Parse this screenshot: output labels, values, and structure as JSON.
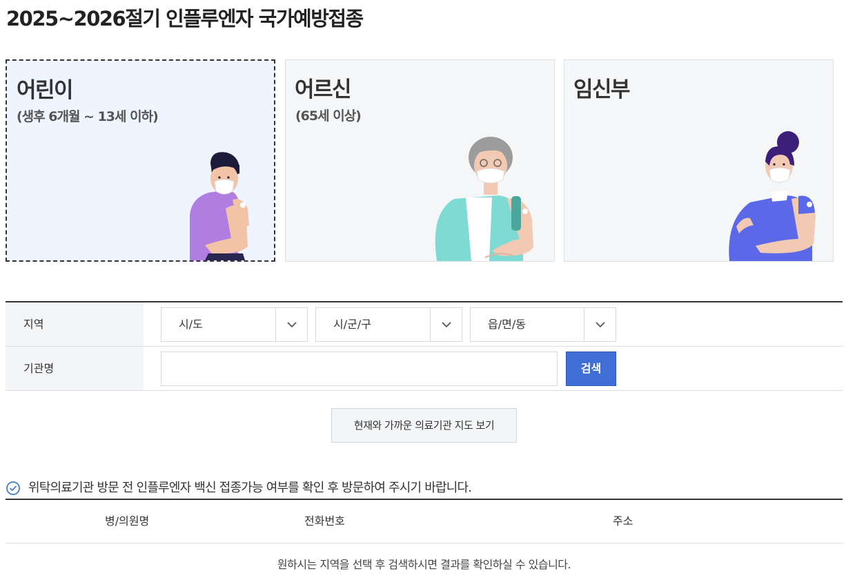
{
  "page": {
    "title": "2025~2026절기 인플루엔자 국가예방접종"
  },
  "cards": [
    {
      "title": "어린이",
      "subtitle": "(생후 6개월 ~ 13세 이하)",
      "selected": true,
      "illustration": "child-vaccination-illustration"
    },
    {
      "title": "어르신",
      "subtitle": "(65세 이상)",
      "selected": false,
      "illustration": "senior-vaccination-illustration"
    },
    {
      "title": "임신부",
      "subtitle": "",
      "selected": false,
      "illustration": "pregnant-vaccination-illustration"
    }
  ],
  "search": {
    "region_label": "지역",
    "sido": "시/도",
    "sigungu": "시/군/구",
    "eupmyeondong": "읍/면/동",
    "org_label": "기관명",
    "org_value": "",
    "search_button": "검색"
  },
  "map_button": "현재와 가까운 의료기관 지도 보기",
  "notice": {
    "icon": "check-circle-icon",
    "text": "위탁의료기관 방문 전 인플루엔자 백신 접종가능 여부를 확인 후 방문하여 주시기 바랍니다."
  },
  "results": {
    "columns": [
      "병/의원명",
      "전화번호",
      "주소"
    ],
    "empty_message": "원하시는 지역을 선택 후 검색하시면 결과를 확인하실 수 있습니다."
  },
  "colors": {
    "accent": "#3f6fd6",
    "selected_card_bg": "#eef5fe",
    "card_bg": "#f5f6f8"
  }
}
